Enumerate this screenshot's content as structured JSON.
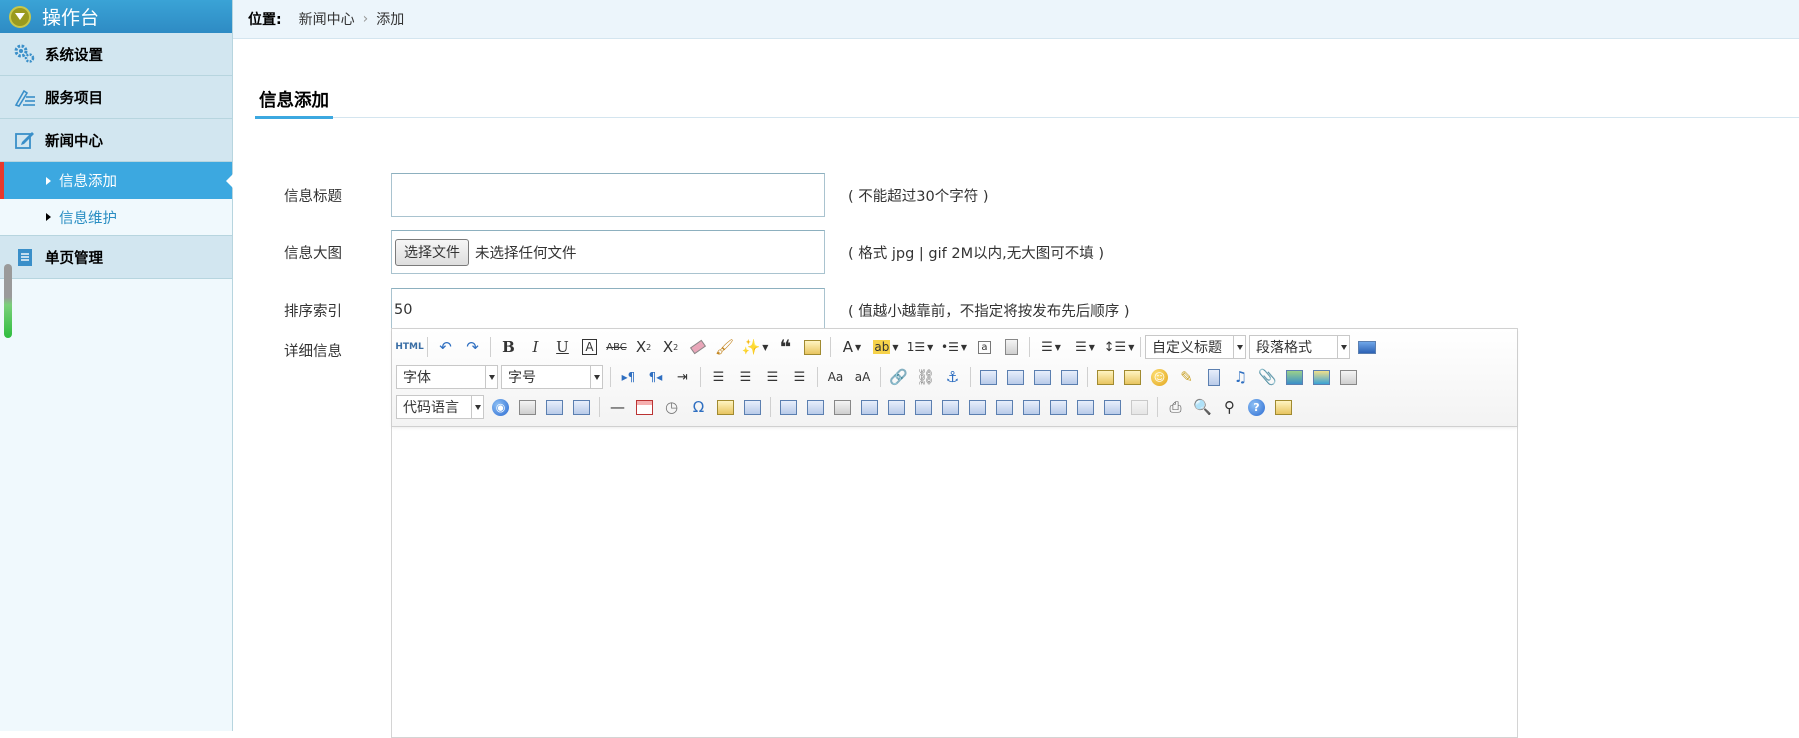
{
  "sidebar": {
    "title": "操作台",
    "menus": [
      {
        "label": "系统设置"
      },
      {
        "label": "服务项目"
      },
      {
        "label": "新闻中心"
      }
    ],
    "sub_items": [
      {
        "label": "信息添加",
        "active": true
      },
      {
        "label": "信息维护",
        "active": false
      }
    ],
    "bottom_menu": {
      "label": "单页管理"
    }
  },
  "breadcrumb": {
    "prefix": "位置:",
    "items": [
      "新闻中心",
      "添加"
    ],
    "separator": "›"
  },
  "tab": {
    "label": "信息添加"
  },
  "form": {
    "title": {
      "label": "信息标题",
      "value": "",
      "hint": "( 不能超过30个字符 )"
    },
    "image": {
      "label": "信息大图",
      "button": "选择文件",
      "status": "未选择任何文件",
      "hint": "( 格式 jpg | gif 2M以内,无大图可不填 )"
    },
    "sort": {
      "label": "排序索引",
      "value": "50",
      "hint": "( 值越小越靠前，不指定将按发布先后顺序 )"
    },
    "detail": {
      "label": "详细信息"
    }
  },
  "editor": {
    "html_label": "HTML",
    "heading_select": "自定义标题",
    "paragraph_select": "段落格式",
    "font_select": "字体",
    "size_select": "字号",
    "code_select": "代码语言",
    "content": ""
  },
  "colors": {
    "accent": "#3ca8e0",
    "active_marker": "#e8392c",
    "sidebar_bg": "#f0f9fd",
    "menu_bg": "#d2e6f0",
    "header": "#2e8bc4"
  }
}
